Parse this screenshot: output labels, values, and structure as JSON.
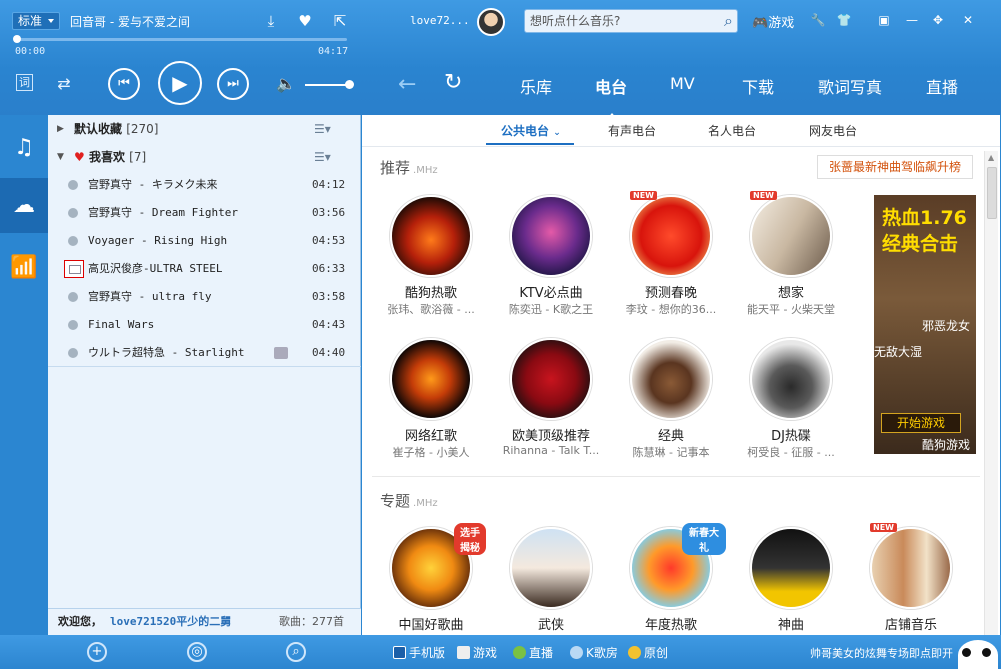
{
  "player": {
    "mode": "标准",
    "now_playing": "回音哥 - 爱与不爱之间",
    "time_current": "00:00",
    "time_total": "04:17",
    "progress": 0,
    "volume": 0.85
  },
  "header": {
    "user": "love72...",
    "search_placeholder": "想听点什么音乐?",
    "game_label": "游戏"
  },
  "nav": {
    "items": [
      "乐库",
      "电台",
      "MV",
      "下载",
      "歌词写真",
      "直播"
    ],
    "active": "电台"
  },
  "playlist": {
    "groups": [
      {
        "label": "默认收藏",
        "count": "[270]"
      },
      {
        "label": "我喜欢",
        "count": "[7]"
      }
    ],
    "songs": [
      {
        "title": "宫野真守 - キラメク未来",
        "duration": "04:12"
      },
      {
        "title": "宫野真守 - Dream Fighter",
        "duration": "03:56"
      },
      {
        "title": "Voyager - Rising  High",
        "duration": "04:53"
      },
      {
        "title": "高见沢俊彦-ULTRA STEEL",
        "duration": "06:33"
      },
      {
        "title": "宫野真守 - ultra fly",
        "duration": "03:58"
      },
      {
        "title": "Final Wars",
        "duration": "04:43"
      },
      {
        "title": "ウルトラ超特急 - Starlight",
        "duration": "04:40"
      }
    ],
    "welcome": "欢迎您，",
    "username": "love721520平少的二舅",
    "song_count": "歌曲：277首"
  },
  "subtabs": [
    "公共电台",
    "有声电台",
    "名人电台",
    "网友电台"
  ],
  "recommend": {
    "title": "推荐",
    "unit": ".MHz",
    "promo": "张蔷最新神曲驾临飙升榜",
    "cards": [
      {
        "name": "酷狗热歌",
        "sub": "张玮、歌浴薇 - ...",
        "badge": ""
      },
      {
        "name": "KTV必点曲",
        "sub": "陈奕迅 - K歌之王",
        "badge": ""
      },
      {
        "name": "预测春晚",
        "sub": "李玟 - 想你的36...",
        "badge": "NEW"
      },
      {
        "name": "想家",
        "sub": "能天平 - 火柴天堂",
        "badge": "NEW"
      },
      {
        "name": "网络红歌",
        "sub": "崔子格 - 小美人",
        "badge": ""
      },
      {
        "name": "欧美顶级推荐",
        "sub": "Rihanna - Talk T...",
        "badge": ""
      },
      {
        "name": "经典",
        "sub": "陈慧琳 - 记事本",
        "badge": ""
      },
      {
        "name": "DJ热碟",
        "sub": "柯受良 - 征服 - ...",
        "badge": ""
      }
    ]
  },
  "ad": {
    "line1": "热血1.76",
    "line2": "经典合击",
    "line3": "邪恶龙女",
    "line4": "无敌大湿",
    "button": "开始游戏",
    "brand": "酷狗游戏"
  },
  "topics": {
    "title": "专题",
    "unit": ".MHz",
    "cards": [
      {
        "name": "中国好歌曲",
        "badge": "选手揭秘"
      },
      {
        "name": "武侠",
        "badge": ""
      },
      {
        "name": "年度热歌",
        "badge": "新春大礼"
      },
      {
        "name": "神曲",
        "badge": ""
      },
      {
        "name": "店铺音乐",
        "badge": "NEW"
      }
    ]
  },
  "bottom": {
    "links": [
      "手机版",
      "游戏",
      "直播",
      "K歌房",
      "原创"
    ],
    "marquee": "帅哥美女的炫舞专场即点即开"
  }
}
